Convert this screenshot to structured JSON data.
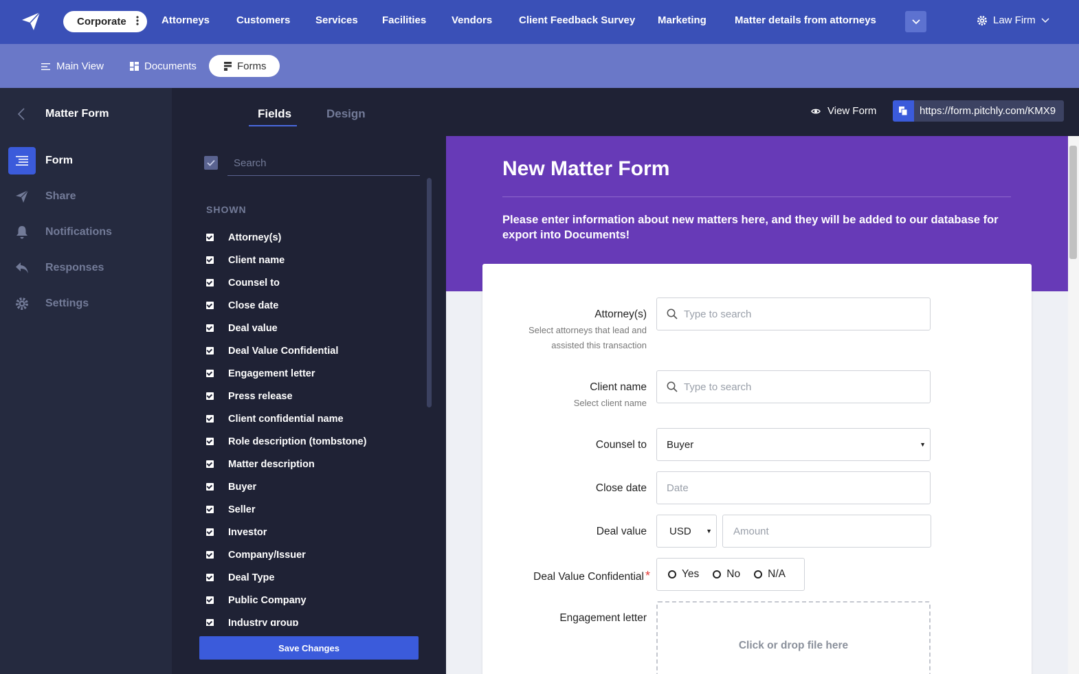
{
  "topnav": {
    "workspace": "Corporate",
    "items": [
      "Attorneys",
      "Customers",
      "Services",
      "Facilities",
      "Vendors",
      "Client Feedback Survey",
      "Marketing",
      "Matter details from attorneys"
    ],
    "firm": "Law Firm"
  },
  "subnav": {
    "items": [
      "Main View",
      "Documents",
      "Forms"
    ],
    "active": "Forms"
  },
  "leftbar": {
    "title": "Matter Form",
    "items": [
      {
        "label": "Form",
        "icon": "menu-icon"
      },
      {
        "label": "Share",
        "icon": "send-icon"
      },
      {
        "label": "Notifications",
        "icon": "bell-icon"
      },
      {
        "label": "Responses",
        "icon": "reply-icon"
      },
      {
        "label": "Settings",
        "icon": "gear-icon"
      }
    ],
    "active": "Form"
  },
  "fields_panel": {
    "tabs": [
      "Fields",
      "Design"
    ],
    "active_tab": "Fields",
    "search_placeholder": "Search",
    "section_label": "SHOWN",
    "fields": [
      "Attorney(s)",
      "Client name",
      "Counsel to",
      "Close date",
      "Deal value",
      "Deal Value Confidential",
      "Engagement letter",
      "Press release",
      "Client confidential name",
      "Role description (tombstone)",
      "Matter description",
      "Buyer",
      "Seller",
      "Investor",
      "Company/Issuer",
      "Deal Type",
      "Public Company",
      "Industry group"
    ],
    "save_label": "Save Changes"
  },
  "header": {
    "view_form": "View Form",
    "url": "https://form.pitchly.com/KMX9"
  },
  "form": {
    "title": "New Matter Form",
    "description": "Please enter information about new matters here, and they will be added to our database for export into Documents!",
    "attorneys": {
      "label": "Attorney(s)",
      "help": "Select attorneys that lead and assisted this transaction",
      "placeholder": "Type to search"
    },
    "client": {
      "label": "Client name",
      "help": "Select client name",
      "placeholder": "Type to search"
    },
    "counsel": {
      "label": "Counsel to",
      "value": "Buyer"
    },
    "close_date": {
      "label": "Close date",
      "placeholder": "Date"
    },
    "deal_value": {
      "label": "Deal value",
      "currency": "USD",
      "placeholder": "Amount"
    },
    "deal_conf": {
      "label": "Deal Value Confidential",
      "required": "*",
      "options": [
        "Yes",
        "No",
        "N/A"
      ]
    },
    "engagement": {
      "label": "Engagement letter",
      "drop_text": "Click or drop file here"
    }
  },
  "colors": {
    "topnav": "#3a50b7",
    "subnav": "#6a78c8",
    "accent": "#3b5bdb",
    "form_header": "#673ab7"
  }
}
